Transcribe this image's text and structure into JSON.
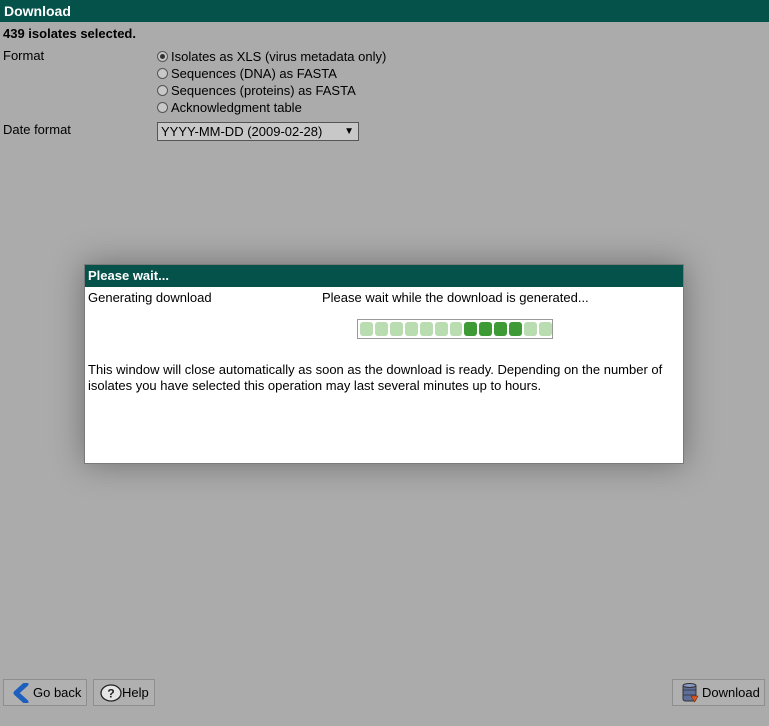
{
  "window": {
    "title": "Download"
  },
  "selection": {
    "count_text": "439 isolates selected."
  },
  "format": {
    "label": "Format",
    "options": [
      {
        "label": "Isolates as XLS (virus metadata only)",
        "checked": true
      },
      {
        "label": "Sequences (DNA) as FASTA",
        "checked": false
      },
      {
        "label": "Sequences (proteins) as FASTA",
        "checked": false
      },
      {
        "label": "Acknowledgment table",
        "checked": false
      }
    ]
  },
  "date_format": {
    "label": "Date format",
    "selected": "YYYY-MM-DD (2009-02-28)"
  },
  "dialog": {
    "title": "Please wait...",
    "label": "Generating download",
    "message": "Please wait while the download is generated...",
    "note": "This window will close automatically as soon as the download is ready. Depending on the number of isolates you have selected this operation may last several minutes up to hours.",
    "progress": {
      "segments_total": 13,
      "active_segments": [
        7,
        8,
        9,
        10
      ]
    }
  },
  "buttons": {
    "back": {
      "label": "Go back",
      "icon": "chevron-left-icon"
    },
    "help": {
      "label": "Help",
      "icon": "question-icon"
    },
    "download": {
      "label": "Download",
      "icon": "database-download-icon"
    }
  },
  "colors": {
    "header": "#05524a",
    "background": "#ababab",
    "progress_active": "#3d9a35",
    "progress_idle": "#b9dcb0"
  }
}
